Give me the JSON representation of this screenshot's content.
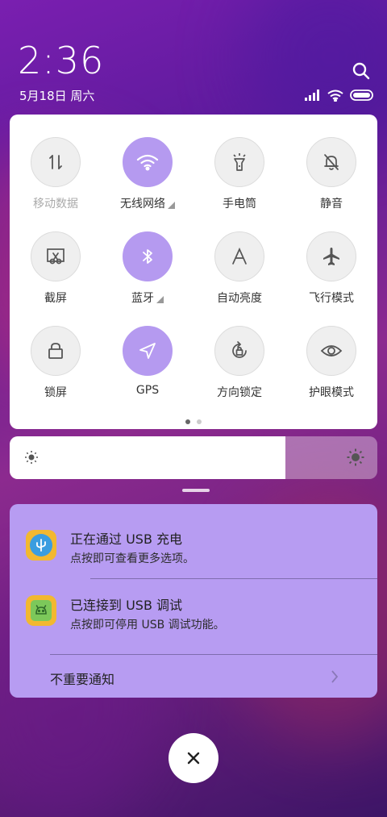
{
  "status": {
    "time": "2:36",
    "date": "5月18日 周六"
  },
  "quick_settings": {
    "tiles": [
      {
        "label": "移动数据",
        "icon": "mobile-data-icon",
        "active": false,
        "disabled": true,
        "expand": false
      },
      {
        "label": "无线网络",
        "icon": "wifi-icon",
        "active": true,
        "disabled": false,
        "expand": true
      },
      {
        "label": "手电筒",
        "icon": "flashlight-icon",
        "active": false,
        "disabled": false,
        "expand": false
      },
      {
        "label": "静音",
        "icon": "mute-bell-icon",
        "active": false,
        "disabled": false,
        "expand": false
      },
      {
        "label": "截屏",
        "icon": "screenshot-icon",
        "active": false,
        "disabled": false,
        "expand": false
      },
      {
        "label": "蓝牙",
        "icon": "bluetooth-icon",
        "active": true,
        "disabled": false,
        "expand": true
      },
      {
        "label": "自动亮度",
        "icon": "auto-brightness-icon",
        "active": false,
        "disabled": false,
        "expand": false
      },
      {
        "label": "飞行模式",
        "icon": "airplane-icon",
        "active": false,
        "disabled": false,
        "expand": false
      },
      {
        "label": "锁屏",
        "icon": "lock-icon",
        "active": false,
        "disabled": false,
        "expand": false
      },
      {
        "label": "GPS",
        "icon": "gps-icon",
        "active": true,
        "disabled": false,
        "expand": false
      },
      {
        "label": "方向锁定",
        "icon": "rotation-lock-icon",
        "active": false,
        "disabled": false,
        "expand": false
      },
      {
        "label": "护眼模式",
        "icon": "eye-icon",
        "active": false,
        "disabled": false,
        "expand": false
      }
    ],
    "current_page": 1,
    "page_count": 2
  },
  "brightness": {
    "level": 0.75
  },
  "notifications": [
    {
      "title": "正在通过 USB 充电",
      "subtitle": "点按即可查看更多选项。",
      "icon": "usb-icon"
    },
    {
      "title": "已连接到 USB 调试",
      "subtitle": "点按即可停用 USB 调试功能。",
      "icon": "android-debug-icon"
    }
  ],
  "unimportant_label": "不重要通知",
  "colors": {
    "accent": "#b59af0",
    "notification_bg": "#b79cf2"
  }
}
